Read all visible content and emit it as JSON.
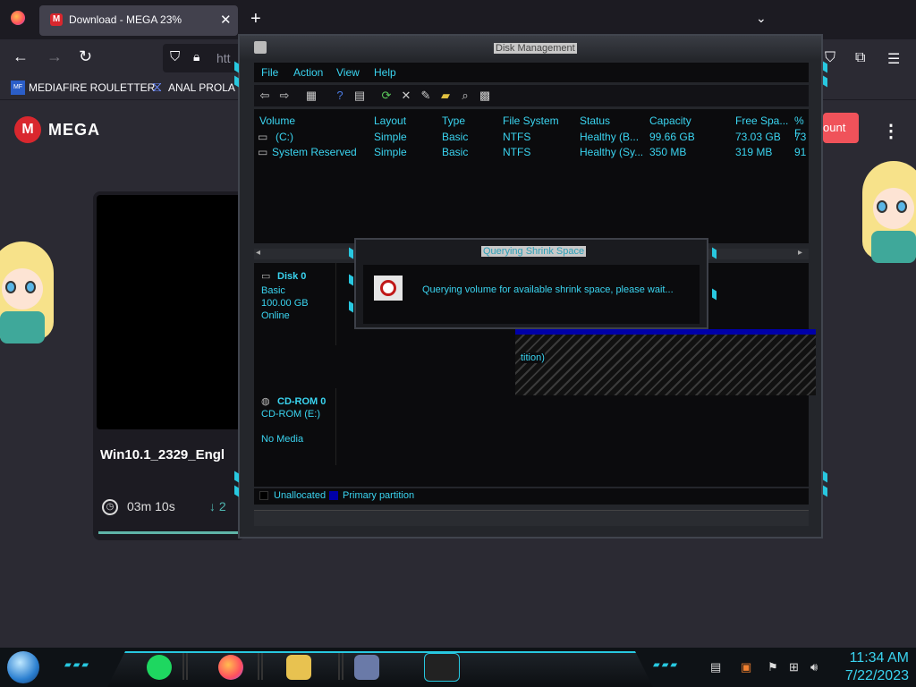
{
  "browser": {
    "tab_title": "Download - MEGA 23%",
    "tab_favicon": "M",
    "url_partial": "htt",
    "bookmarks": [
      {
        "icon_text": "MF",
        "label": "MEDIAFIRE ROULETTER"
      },
      {
        "label": "ANAL PROLA"
      }
    ],
    "colors": {
      "chrome": "#1c1b22",
      "toolbar": "#2b2a33"
    }
  },
  "mega": {
    "logo_letter": "M",
    "brand": "MEGA",
    "filename": "Win10.1_2329_Engl",
    "time_remaining": "03m 10s",
    "speed_prefix": "↓ 2",
    "progress_percent": 23,
    "button_label": "ount",
    "accent": "#d9272e"
  },
  "disk_mgmt": {
    "title": "Disk Management",
    "menu": [
      "File",
      "Action",
      "View",
      "Help"
    ],
    "columns": [
      "Volume",
      "Layout",
      "Type",
      "File System",
      "Status",
      "Capacity",
      "Free Spa...",
      "% F"
    ],
    "rows": [
      {
        "volume": "(C:)",
        "layout": "Simple",
        "type": "Basic",
        "fs": "NTFS",
        "status": "Healthy (B...",
        "capacity": "99.66 GB",
        "free": "73.03 GB",
        "pct": "73 %"
      },
      {
        "volume": "System Reserved",
        "layout": "Simple",
        "type": "Basic",
        "fs": "NTFS",
        "status": "Healthy (Sy...",
        "capacity": "350 MB",
        "free": "319 MB",
        "pct": "91 %"
      }
    ],
    "disks": [
      {
        "name": "Disk 0",
        "type": "Basic",
        "size": "100.00 GB",
        "state": "Online"
      },
      {
        "name": "CD-ROM 0",
        "type": "CD-ROM (E:)",
        "size": "",
        "state": "No Media"
      }
    ],
    "partition_label_fragment": "tition)",
    "legend": [
      "Unallocated",
      "Primary partition"
    ],
    "text_color": "#3ad4f0"
  },
  "dialog": {
    "title": "Querying Shrink Space",
    "message": "Querying volume for available shrink space, please wait..."
  },
  "taskbar": {
    "time": "11:34 AM",
    "date": "7/22/2023"
  }
}
